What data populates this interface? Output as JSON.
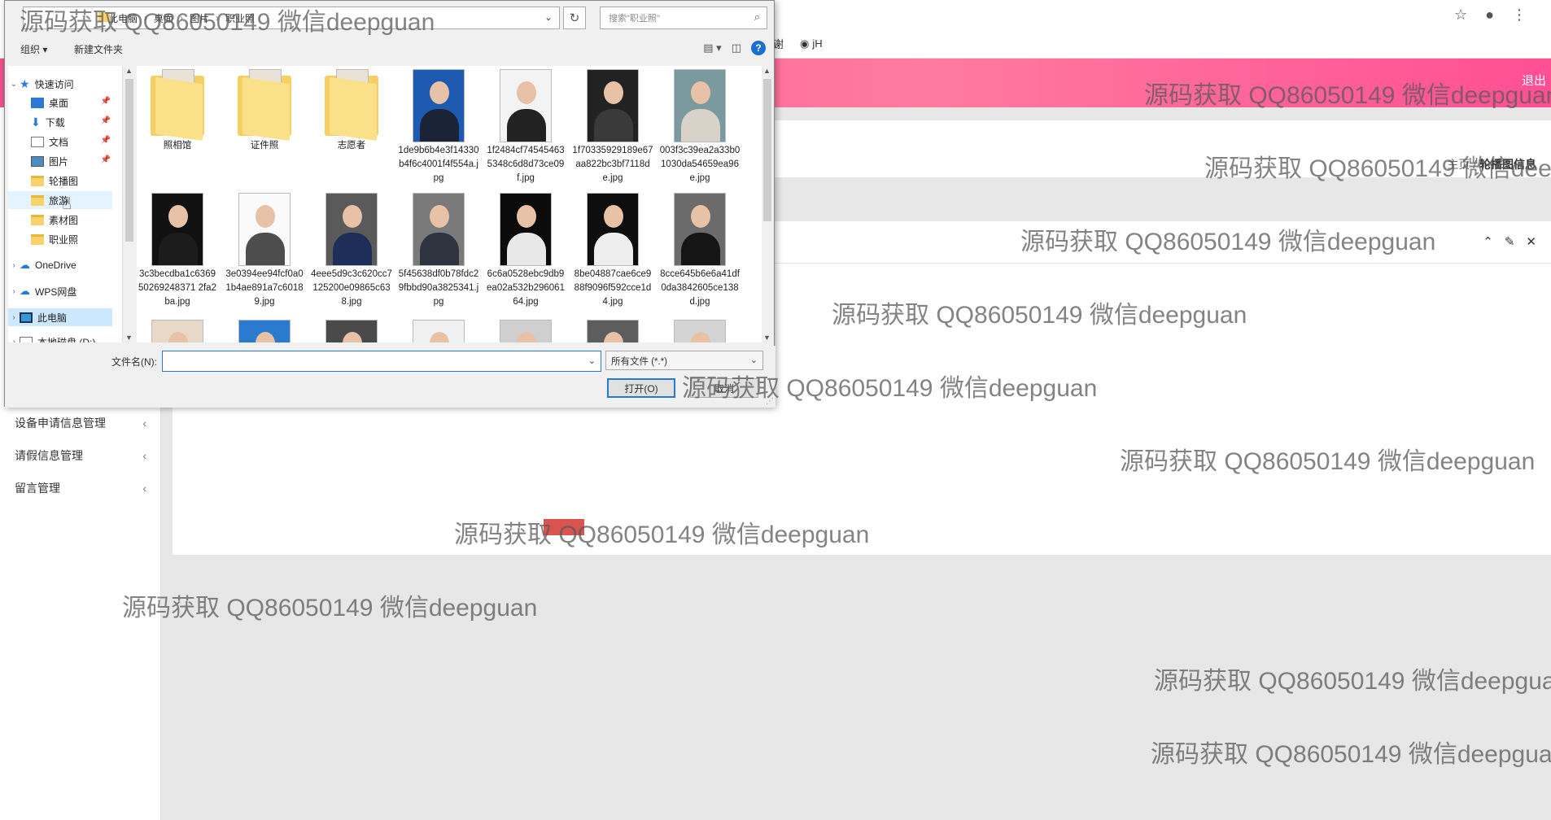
{
  "browser": {
    "bookmarks": [
      "谢",
      "jH"
    ],
    "icons": [
      "star-icon",
      "account-icon",
      "menu-icon"
    ]
  },
  "app": {
    "logout": "退出",
    "breadcrumb": {
      "home": "主页",
      "separator": "/",
      "current": "轮播图信息"
    },
    "sidebar": [
      {
        "label": "设备申请信息管理"
      },
      {
        "label": "请假信息管理"
      },
      {
        "label": "留言管理"
      }
    ],
    "accent": "#ff5b94"
  },
  "dialog": {
    "address": {
      "root": "此电脑",
      "parts": [
        "桌面",
        "图片",
        "职业照"
      ]
    },
    "search_placeholder": "搜索\"职业照\"",
    "toolbar": {
      "organize": "组织 ▾",
      "new_folder": "新建文件夹"
    },
    "nav": [
      {
        "label": "快速访问",
        "icon": "star-icon"
      },
      {
        "label": "桌面",
        "icon": "desktop-icon"
      },
      {
        "label": "下载",
        "icon": "download-icon"
      },
      {
        "label": "文档",
        "icon": "document-icon"
      },
      {
        "label": "图片",
        "icon": "pictures-icon"
      },
      {
        "label": "轮播图",
        "icon": "folder-icon"
      },
      {
        "label": "旅游",
        "icon": "folder-icon"
      },
      {
        "label": "素材图",
        "icon": "folder-icon"
      },
      {
        "label": "职业照",
        "icon": "folder-icon"
      },
      {
        "label": "OneDrive",
        "icon": "cloud-icon"
      },
      {
        "label": "WPS网盘",
        "icon": "cloud-icon"
      },
      {
        "label": "此电脑",
        "icon": "pc-icon"
      },
      {
        "label": "本地磁盘 (D:)",
        "icon": "drive-icon"
      }
    ],
    "files": [
      {
        "name": "照相馆",
        "kind": "folder"
      },
      {
        "name": "证件照",
        "kind": "folder"
      },
      {
        "name": "志愿者",
        "kind": "folder"
      },
      {
        "name": "1de9b6b4e3f14330b4f6c4001f4f554a.jpg",
        "kind": "photo",
        "bg": "#1e5bb0",
        "suit": "#1b2436"
      },
      {
        "name": "1f2484cf745454635348c6d8d73ce09f.jpg",
        "kind": "photo",
        "bg": "#f3f3f3",
        "suit": "#222"
      },
      {
        "name": "1f70335929189e67aa822bc3bf7118de.jpg",
        "kind": "photo",
        "bg": "#222",
        "suit": "#3a3a3a"
      },
      {
        "name": "003f3c39ea2a33b01030da54659ea96e.jpg",
        "kind": "photo",
        "bg": "#7a9aa0",
        "suit": "#d9d2c8"
      },
      {
        "name": "3c3becdba1c636950269248371 2fa2ba.jpg",
        "kind": "photo",
        "bg": "#111",
        "suit": "#1c1c1c"
      },
      {
        "name": "3e0394ee94fcf0a01b4ae891a7c60189.jpg",
        "kind": "photo",
        "bg": "#fafafa",
        "suit": "#4d4d4d"
      },
      {
        "name": "4eee5d9c3c620cc7125200e09865c638.jpg",
        "kind": "photo",
        "bg": "#5a5a5a",
        "suit": "#1d2f58"
      },
      {
        "name": "5f45638df0b78fdc29fbbd90a3825341.jpg",
        "kind": "photo",
        "bg": "#7a7a7a",
        "suit": "#2e3340"
      },
      {
        "name": "6c6a0528ebc9db9ea02a532b29606164.jpg",
        "kind": "photo",
        "bg": "#0b0b0b",
        "suit": "#e8e8e8"
      },
      {
        "name": "8be04887cae6ce988f9096f592cce1d4.jpg",
        "kind": "photo",
        "bg": "#0e0e0e",
        "suit": "#eeeeee"
      },
      {
        "name": "8cce645b6e6a41df0da3842605ce138d.jpg",
        "kind": "photo",
        "bg": "#6b6b6b",
        "suit": "#151515"
      }
    ],
    "filename_label": "文件名(N):",
    "filename_value": "",
    "filetype": "所有文件 (*.*)",
    "open_button": "打开(O)",
    "cancel_button": "取消"
  },
  "watermark": "源码获取 QQ86050149 微信deepguan"
}
